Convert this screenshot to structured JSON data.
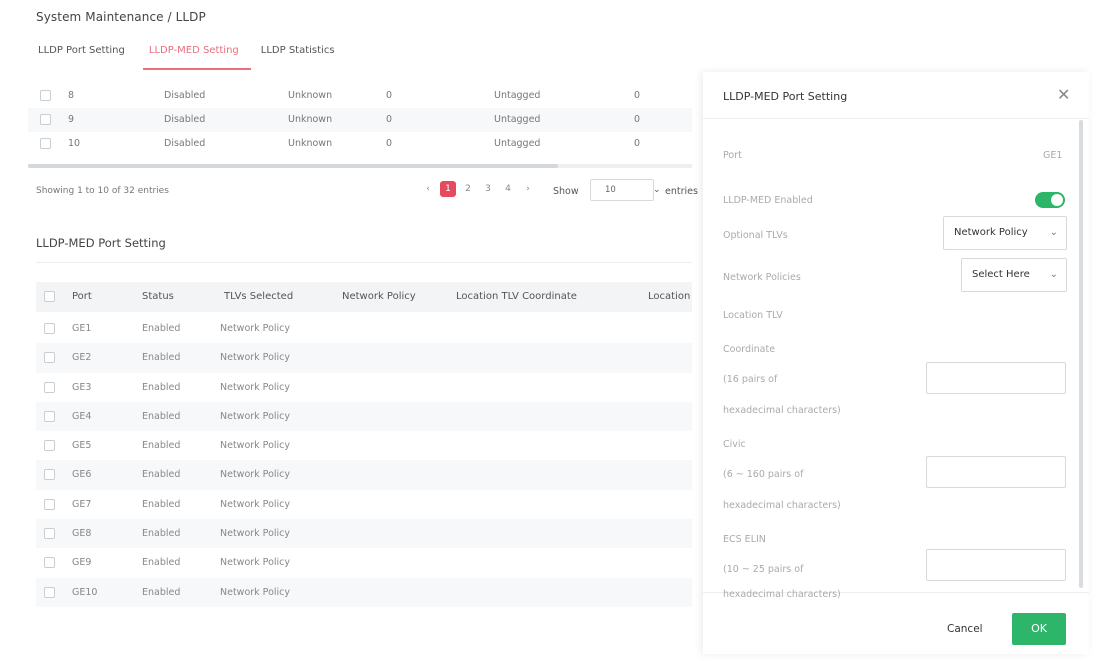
{
  "breadcrumb": "System Maintenance / LLDP",
  "tabs": [
    {
      "label": "LLDP Port Setting"
    },
    {
      "label": "LLDP-MED Setting"
    },
    {
      "label": "LLDP Statistics"
    }
  ],
  "top_table": {
    "rows": [
      {
        "port": "8",
        "status": "Disabled",
        "capability": "Unknown",
        "vlan": "0",
        "tag": "Untagged",
        "priority": "0"
      },
      {
        "port": "9",
        "status": "Disabled",
        "capability": "Unknown",
        "vlan": "0",
        "tag": "Untagged",
        "priority": "0"
      },
      {
        "port": "10",
        "status": "Disabled",
        "capability": "Unknown",
        "vlan": "0",
        "tag": "Untagged",
        "priority": "0"
      }
    ]
  },
  "pagination": {
    "showing": "Showing 1 to 10 of 32 entries",
    "prev": "‹",
    "pages": [
      "1",
      "2",
      "3",
      "4"
    ],
    "next": "›",
    "show_label": "Show",
    "entries_value": "10",
    "entries_label": "entries"
  },
  "port_setting": {
    "title": "LLDP-MED Port Setting",
    "columns": [
      "Port",
      "Status",
      "TLVs Selected",
      "Network Policy",
      "Location TLV Coordinate",
      "Location"
    ],
    "rows": [
      {
        "port": "GE1",
        "status": "Enabled",
        "tlvs": "Network Policy"
      },
      {
        "port": "GE2",
        "status": "Enabled",
        "tlvs": "Network Policy"
      },
      {
        "port": "GE3",
        "status": "Enabled",
        "tlvs": "Network Policy"
      },
      {
        "port": "GE4",
        "status": "Enabled",
        "tlvs": "Network Policy"
      },
      {
        "port": "GE5",
        "status": "Enabled",
        "tlvs": "Network Policy"
      },
      {
        "port": "GE6",
        "status": "Enabled",
        "tlvs": "Network Policy"
      },
      {
        "port": "GE7",
        "status": "Enabled",
        "tlvs": "Network Policy"
      },
      {
        "port": "GE8",
        "status": "Enabled",
        "tlvs": "Network Policy"
      },
      {
        "port": "GE9",
        "status": "Enabled",
        "tlvs": "Network Policy"
      },
      {
        "port": "GE10",
        "status": "Enabled",
        "tlvs": "Network Policy"
      }
    ]
  },
  "drawer": {
    "title": "LLDP-MED Port Setting",
    "port_label": "Port",
    "port_value": "GE1",
    "med_enabled_label": "LLDP-MED Enabled",
    "optional_tlvs_label": "Optional TLVs",
    "optional_tlvs_value": "Network Policy",
    "network_policies_label": "Network Policies",
    "network_policies_value": "Select Here",
    "location_tlv_label": "Location TLV",
    "coordinate_label": "Coordinate",
    "coordinate_hint1": "(16 pairs of",
    "coordinate_hint2": "hexadecimal characters)",
    "civic_label": "Civic",
    "civic_hint1": "(6 ~ 160 pairs of",
    "civic_hint2": "hexadecimal characters)",
    "ecs_label": "ECS ELIN",
    "ecs_hint1": "(10 ~ 25 pairs of",
    "ecs_hint2": "hexadecimal characters)",
    "cancel_label": "Cancel",
    "ok_label": "OK"
  },
  "colors": {
    "accent": "#e8707f",
    "page_active": "#e54a5e",
    "success": "#2db66a"
  }
}
